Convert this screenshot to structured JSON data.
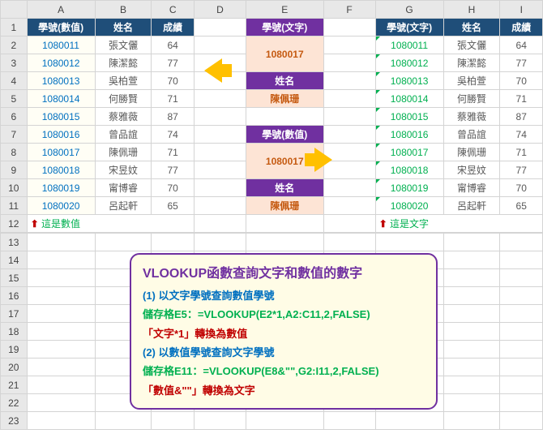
{
  "cols": [
    "A",
    "B",
    "C",
    "D",
    "E",
    "F",
    "G",
    "H",
    "I"
  ],
  "left_header": [
    "學號(數值)",
    "姓名",
    "成績"
  ],
  "right_header": [
    "學號(文字)",
    "姓名",
    "成績"
  ],
  "center_labels": {
    "text_id": "學號(文字)",
    "name": "姓名",
    "num_id": "學號(數值)"
  },
  "lookup1": "1080017",
  "lookup1_result": "陳佩珊",
  "lookup2": "1080017",
  "lookup2_result": "陳佩珊",
  "note_left": "這是數值",
  "note_right": "這是文字",
  "arrow_glyph": "⬆",
  "rows": [
    {
      "id": "1080011",
      "name": "張文儷",
      "score": "64"
    },
    {
      "id": "1080012",
      "name": "陳潔懿",
      "score": "77"
    },
    {
      "id": "1080013",
      "name": "吳柏萱",
      "score": "70"
    },
    {
      "id": "1080014",
      "name": "何勝賢",
      "score": "71"
    },
    {
      "id": "1080015",
      "name": "蔡雅薇",
      "score": "87"
    },
    {
      "id": "1080016",
      "name": "曾品誼",
      "score": "74"
    },
    {
      "id": "1080017",
      "name": "陳佩珊",
      "score": "71"
    },
    {
      "id": "1080018",
      "name": "宋昱妏",
      "score": "77"
    },
    {
      "id": "1080019",
      "name": "甯博睿",
      "score": "70"
    },
    {
      "id": "1080020",
      "name": "呂起軒",
      "score": "65"
    }
  ],
  "infobox": {
    "title": "VLOOKUP函數查詢文字和數值的數字",
    "line1": "(1) 以文字學號查詢數值學號",
    "line2": "儲存格E5：=VLOOKUP(E2*1,A2:C11,2,FALSE)",
    "line3": "「文字*1」轉換為數值",
    "line4": "(2) 以數值學號查詢文字學號",
    "line5": "儲存格E11：=VLOOKUP(E8&\"\",G2:I11,2,FALSE)",
    "line6": "「數值&\"\"」轉換為文字"
  }
}
